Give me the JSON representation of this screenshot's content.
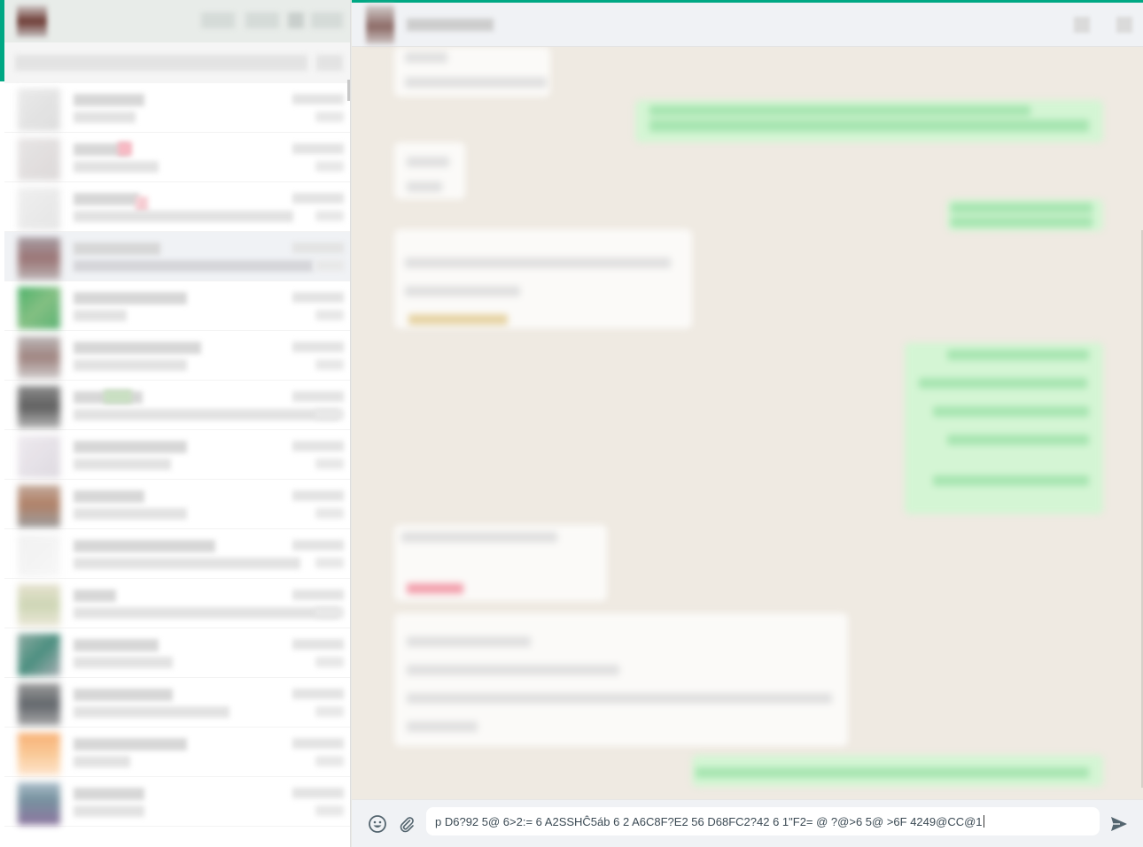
{
  "app": {
    "accent_color": "#00a884",
    "panel_bg": "#f0f2f5",
    "chat_bg": "#efeae2",
    "outgoing_bubble_color": "#d4f5d4",
    "incoming_bubble_color": "#fbfaf8"
  },
  "sidebar": {
    "header_icons": [
      "avatar",
      "status-icon",
      "new-chat-icon",
      "menu-icon"
    ],
    "search_placeholder": "",
    "chats": [
      {
        "avatar_colors": [
          "#a99c9a",
          "#c2bbb9"
        ]
      },
      {
        "avatar_colors": [
          "#d9d6d6",
          "#e5a8b0"
        ]
      },
      {
        "avatar_colors": [
          "#e6e6e6",
          "#f1d9de"
        ]
      },
      {
        "avatar_colors": [
          "#9a8e95",
          "#b49a9a"
        ],
        "selected": true
      },
      {
        "avatar_colors": [
          "#2ea44f",
          "#6fb56e"
        ]
      },
      {
        "avatar_colors": [
          "#8f8887",
          "#9f8580"
        ]
      },
      {
        "avatar_colors": [
          "#555555",
          "#999999"
        ]
      },
      {
        "avatar_colors": [
          "#ebe6ec",
          "#d9d4dc"
        ]
      },
      {
        "avatar_colors": [
          "#a36b4d",
          "#8c8c8c"
        ]
      },
      {
        "avatar_colors": [
          "#eaeaea",
          "#f3f3f3"
        ]
      },
      {
        "avatar_colors": [
          "#d0cbb2",
          "#c5cfa8"
        ]
      },
      {
        "avatar_colors": [
          "#2e7d6b",
          "#9aa0a6"
        ]
      },
      {
        "avatar_colors": [
          "#474c52",
          "#9a9a9a"
        ]
      },
      {
        "avatar_colors": [
          "#f6a35d",
          "#f9c085"
        ]
      },
      {
        "avatar_colors": [
          "#5f7f8f",
          "#7a5f8f"
        ]
      }
    ]
  },
  "conversation": {
    "header_title": "",
    "header_icons": [
      "search-icon",
      "menu-icon"
    ]
  },
  "composer": {
    "emoji_icon": "emoji-icon",
    "attach_icon": "paperclip-icon",
    "send_icon": "send-icon",
    "input_value": "p D6?92 5@ 6>2:= 6 A2SSHĈ5áb 6 2 A6C8F?E2 56 D68FC2?42 6 1\"F2= @ ?@>6 5@ >6F 4249@CC@1"
  }
}
